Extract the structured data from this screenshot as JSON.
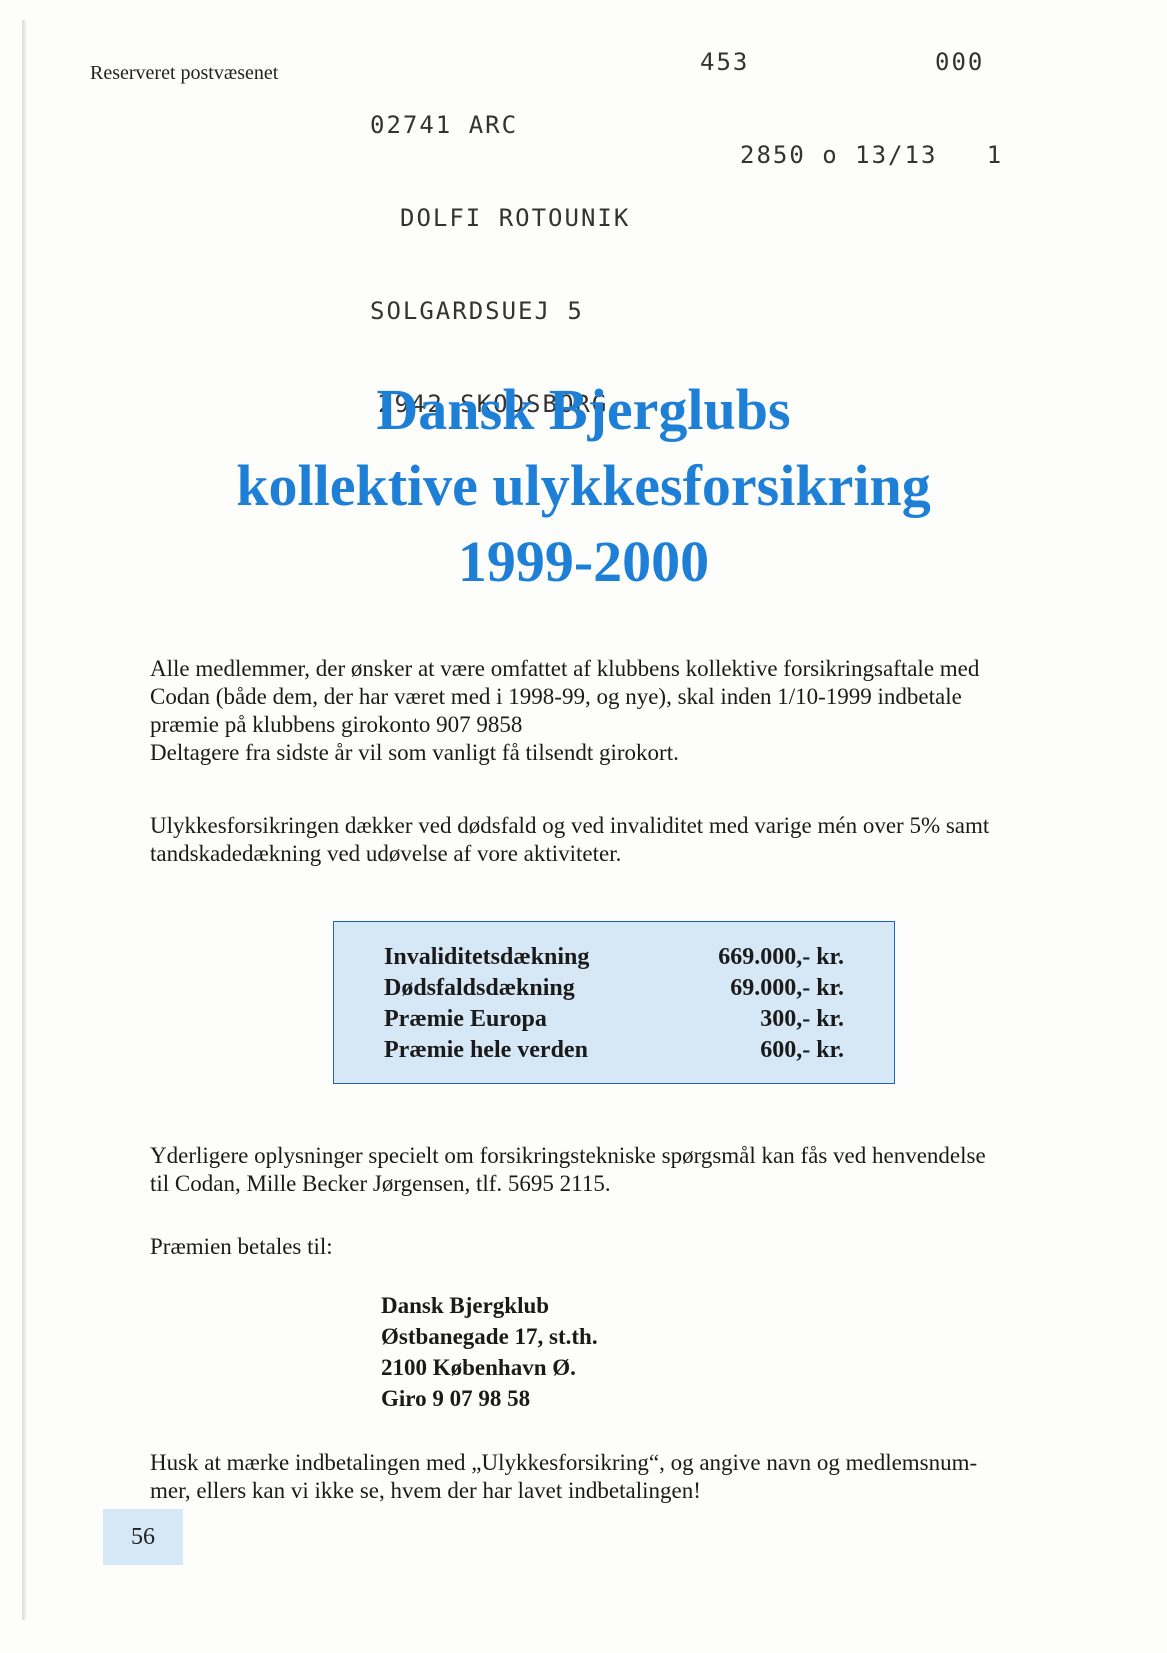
{
  "header": {
    "reserved_label": "Reserveret postvæsenet",
    "address_lines": [
      "02741 ARC",
      "DOLFI ROTOUNIK",
      "SOLGARDSUEJ 5",
      "2942 SKODSBORG"
    ],
    "code_453": "453",
    "code_000": "000",
    "postal_line": "2850 o 13/13   1"
  },
  "title": {
    "line1": "Dansk Bjerglubs",
    "line2": "kollektive ulykkesforsikring",
    "line3": "1999-2000"
  },
  "intro": {
    "line1": "Alle medlemmer, der ønsker at være omfattet af klubbens kollektive forsikringsaftale med",
    "line2": "Codan (både dem, der har været med i 1998-99, og nye), skal inden 1/10-1999 indbetale",
    "line3": "præmie på klubbens girokonto 907 9858",
    "line4": "Deltagere fra sidste år vil som vanligt få tilsendt girokort."
  },
  "coverage_text": {
    "line1": "Ulykkesforsikringen dækker ved dødsfald og ved invaliditet med varige mén over 5% samt",
    "line2": "tandskadedækning ved udøvelse af vore aktiviteter."
  },
  "coverage": [
    {
      "label": "Invaliditetsdækning",
      "value": "669.000,- kr."
    },
    {
      "label": "Dødsfaldsdækning",
      "value": "69.000,- kr."
    },
    {
      "label": "Præmie Europa",
      "value": "300,- kr."
    },
    {
      "label": "Præmie hele verden",
      "value": "600,- kr."
    }
  ],
  "info": {
    "line1": "Yderligere oplysninger specielt om forsikringstekniske spørgsmål kan fås ved henvendelse",
    "line2": "til Codan, Mille Becker Jørgensen, tlf. 5695 2115."
  },
  "pay_to_label": "Præmien betales til:",
  "payee": {
    "name": "Dansk Bjergklub",
    "street": "Østbanegade 17, st.th.",
    "city": "2100 København Ø.",
    "giro": "Giro 9 07 98 58"
  },
  "reminder": {
    "line1": "Husk at mærke indbetalingen med „Ulykkesforsikring“, og angive navn og medlemsnum-",
    "line2": "mer, ellers kan vi ikke se, hvem der har lavet indbetalingen!"
  },
  "page_number": "56",
  "colors": {
    "title": "#1e7fd6",
    "box_fill": "#d6e8f6",
    "box_border": "#1e64b4"
  }
}
